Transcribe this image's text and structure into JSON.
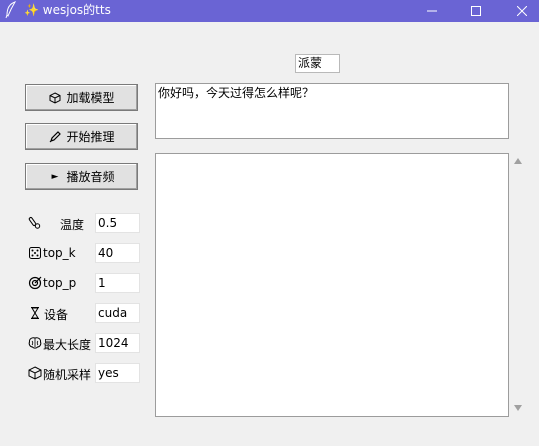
{
  "window": {
    "title": "wesjos的tts",
    "title_sparkle": "✨",
    "accent_color": "#6a64d4"
  },
  "buttons": {
    "load_model": {
      "label": "加载模型",
      "icon": "cube-icon"
    },
    "start_inference": {
      "label": "开始推理",
      "icon": "pencil-icon"
    },
    "play_audio": {
      "label": "播放音频",
      "icon": "play-triangle-icon",
      "glyph": "►"
    }
  },
  "speaker": {
    "value": "派蒙"
  },
  "input_text": {
    "value": "你好吗，今天过得怎么样呢？"
  },
  "output_text": {
    "value": ""
  },
  "params": [
    {
      "label": "温度",
      "value": "0.5",
      "icon": "thermometer-icon"
    },
    {
      "label": "top_k",
      "value": "40",
      "icon": "dice-icon"
    },
    {
      "label": "top_p",
      "value": "1",
      "icon": "target-icon"
    },
    {
      "label": "设备",
      "value": "cuda",
      "icon": "hourglass-icon"
    },
    {
      "label": "最大长度",
      "value": "1024",
      "icon": "brain-icon"
    },
    {
      "label": "随机采样",
      "value": "yes",
      "icon": "box-icon"
    }
  ]
}
